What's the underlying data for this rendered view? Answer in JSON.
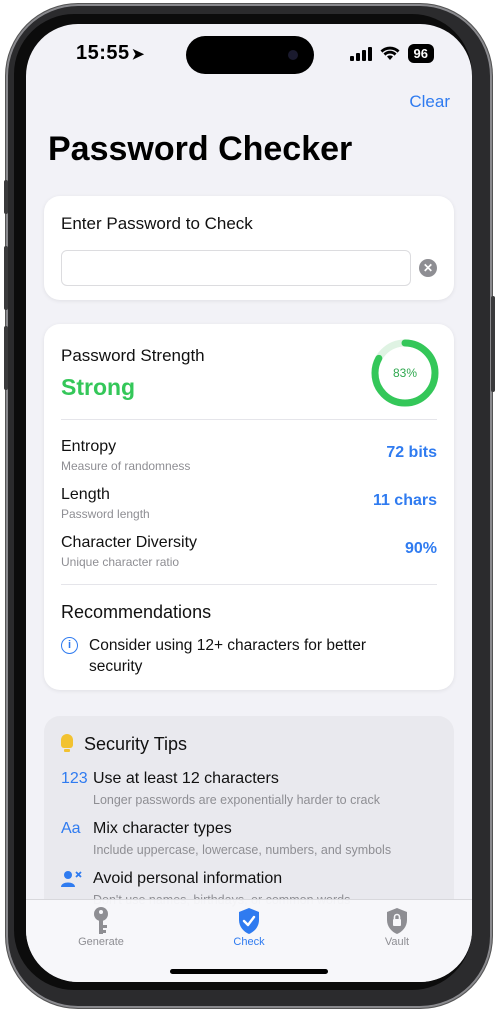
{
  "status": {
    "time": "15:55",
    "battery": "96"
  },
  "header": {
    "clear_label": "Clear",
    "title": "Password Checker"
  },
  "input_card": {
    "label": "Enter Password to Check",
    "value": "",
    "placeholder": ""
  },
  "strength": {
    "label": "Password Strength",
    "value": "Strong",
    "percent_text": "83%",
    "percent": 0.83,
    "metrics": [
      {
        "label": "Entropy",
        "sub": "Measure of randomness",
        "value": "72 bits"
      },
      {
        "label": "Length",
        "sub": "Password length",
        "value": "11 chars"
      },
      {
        "label": "Character Diversity",
        "sub": "Unique character ratio",
        "value": "90%"
      }
    ],
    "recommendations_title": "Recommendations",
    "recommendations": [
      "Consider using 12+ characters for better security"
    ]
  },
  "tips": {
    "title": "Security Tips",
    "items": [
      {
        "icon_text": "123",
        "icon": "numbers-icon",
        "main": "Use at least 12 characters",
        "sub": "Longer passwords are exponentially harder to crack"
      },
      {
        "icon_text": "Aa",
        "icon": "text-case-icon",
        "main": "Mix character types",
        "sub": "Include uppercase, lowercase, numbers, and symbols"
      },
      {
        "icon_text": "",
        "icon": "person-x-icon",
        "main": "Avoid personal information",
        "sub": "Don't use names, birthdays, or common words"
      }
    ]
  },
  "tabs": [
    {
      "label": "Generate",
      "icon": "key-icon",
      "active": false
    },
    {
      "label": "Check",
      "icon": "shield-check-icon",
      "active": true
    },
    {
      "label": "Vault",
      "icon": "lock-icon",
      "active": false
    }
  ],
  "colors": {
    "accent": "#2f7bf0",
    "strong": "#34c759"
  }
}
